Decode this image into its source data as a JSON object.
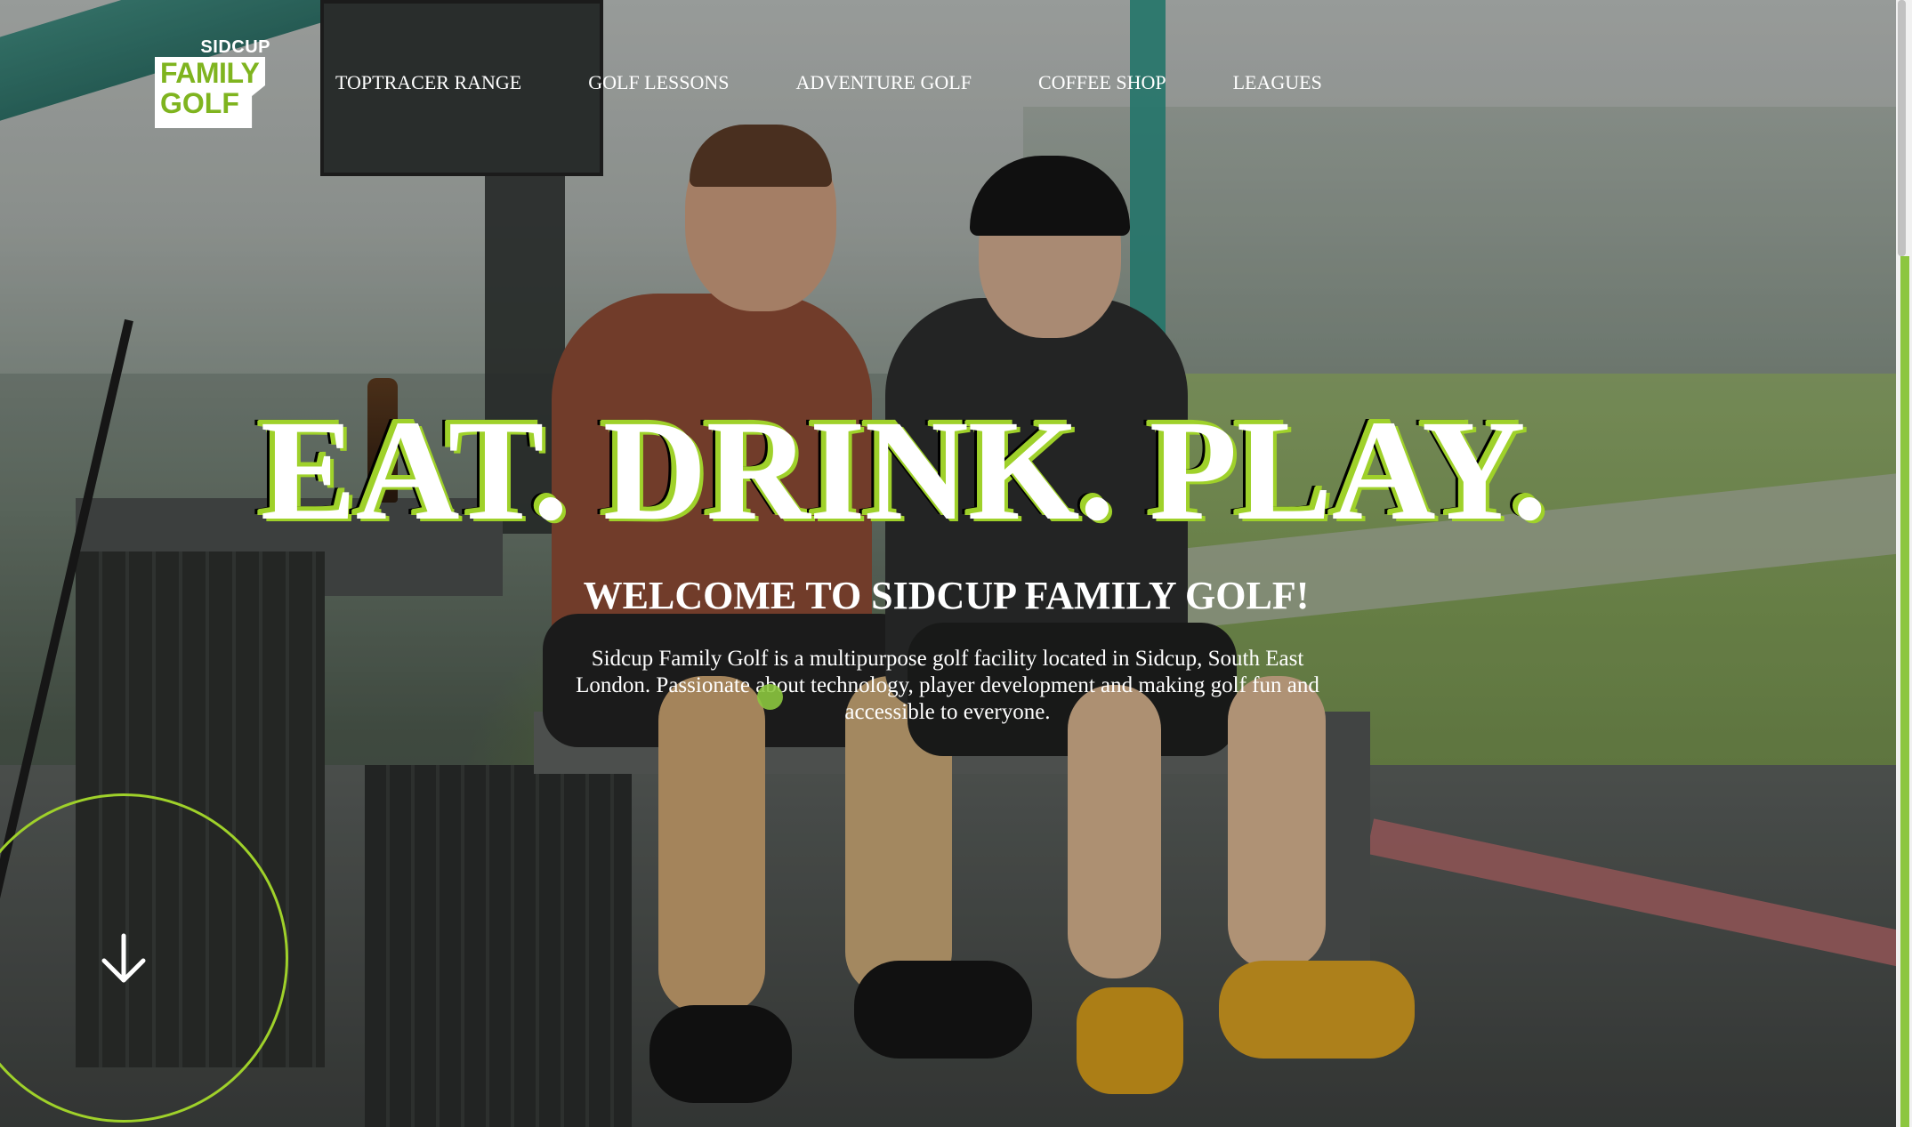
{
  "header": {
    "logo": {
      "top": "SIDCUP",
      "line1": "FAMILY",
      "line2": "GOLF"
    },
    "nav": [
      {
        "label": "TOPTRACER RANGE"
      },
      {
        "label": "GOLF LESSONS"
      },
      {
        "label": "ADVENTURE GOLF"
      },
      {
        "label": "COFFEE SHOP"
      },
      {
        "label": "LEAGUES"
      }
    ]
  },
  "hero": {
    "headline": "EAT. DRINK. PLAY.",
    "subheading": "WELCOME TO SIDCUP FAMILY GOLF!",
    "description": "Sidcup Family Golf is a multipurpose golf facility located in Sidcup, South East London. Passionate about technology, player development and making golf fun and accessible to everyone."
  },
  "colors": {
    "accent_green": "#9fd12a",
    "logo_green": "#7fb41f"
  },
  "icons": {
    "scroll_down": "arrow-down-icon"
  }
}
